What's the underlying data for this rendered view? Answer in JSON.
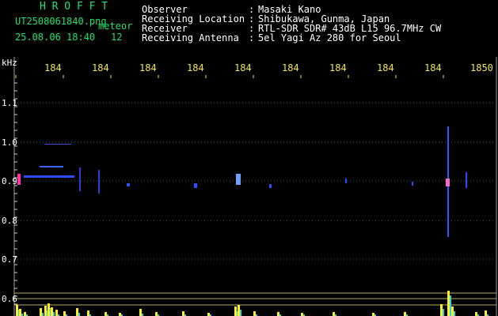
{
  "title": "H R O F F T",
  "filename": "UT2508061840.png",
  "mode": "meteor",
  "datetime": "25.08.06 18:40",
  "count": "12",
  "info": [
    {
      "key": "Observer",
      "sep": ":",
      "value": "Masaki Kano"
    },
    {
      "key": "Receiving Location",
      "sep": ":",
      "value": "Shibukawa, Gunma, Japan"
    },
    {
      "key": "Receiver",
      "sep": ":",
      "value": "RTL-SDR SDR# 43dB L15 96.7MHz CW"
    },
    {
      "key": "Receiving Antenna",
      "sep": ":",
      "value": "5el Yagi Az 280 for Seoul"
    }
  ],
  "y_unit": "kHz",
  "time_labels": [
    "184",
    "184",
    "184",
    "184",
    "184",
    "184",
    "184",
    "184",
    "184",
    "1850"
  ],
  "freq_labels": [
    "1.1",
    "1.0",
    "0.9",
    "0.8",
    "0.7",
    "0.6"
  ],
  "colors": {
    "green": "#1fe36a",
    "yellow": "#f0e64a",
    "grid": "#2f6a3a",
    "signal": "#2b4dff",
    "histogram": "#ffee22"
  }
}
